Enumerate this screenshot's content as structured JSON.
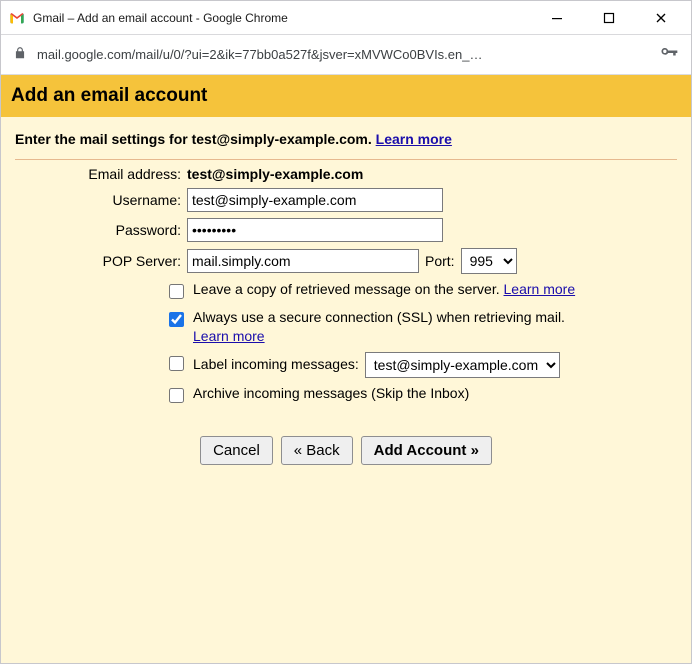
{
  "window": {
    "title": "Gmail – Add an email account - Google Chrome",
    "url": "mail.google.com/mail/u/0/?ui=2&ik=77bb0a527f&jsver=xMVWCo0BVIs.en_…"
  },
  "page": {
    "heading": "Add an email account",
    "intro_prefix": "Enter the mail settings for ",
    "intro_email": "test@simply-example.com",
    "intro_suffix": ". ",
    "learn_more": "Learn more"
  },
  "form": {
    "email_label": "Email address:",
    "email_value": "test@simply-example.com",
    "username_label": "Username:",
    "username_value": "test@simply-example.com",
    "password_label": "Password:",
    "password_value": "•••••••••",
    "pop_label": "POP Server:",
    "pop_value": "mail.simply.com",
    "port_label": "Port:",
    "port_value": "995"
  },
  "options": {
    "leave_copy": {
      "checked": false,
      "text": "Leave a copy of retrieved message on the server. ",
      "link": "Learn more"
    },
    "ssl": {
      "checked": true,
      "text": "Always use a secure connection (SSL) when retrieving mail. ",
      "link": "Learn more"
    },
    "label_msgs": {
      "checked": false,
      "text": "Label incoming messages: ",
      "select": "test@simply-example.com"
    },
    "archive": {
      "checked": false,
      "text": "Archive incoming messages (Skip the Inbox)"
    }
  },
  "buttons": {
    "cancel": "Cancel",
    "back": "« Back",
    "add": "Add Account »"
  }
}
